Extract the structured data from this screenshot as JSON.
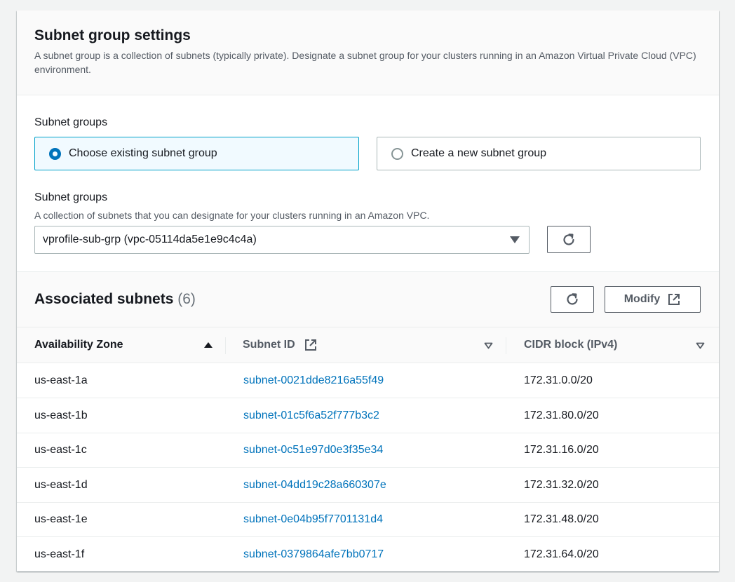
{
  "header": {
    "title": "Subnet group settings",
    "description": "A subnet group is a collection of subnets (typically private). Designate a subnet group for your clusters running in an Amazon Virtual Private Cloud (VPC) environment."
  },
  "subnet_group_choice": {
    "label": "Subnet groups",
    "options": [
      {
        "label": "Choose existing subnet group",
        "selected": true
      },
      {
        "label": "Create a new subnet group",
        "selected": false
      }
    ]
  },
  "subnet_group_select": {
    "label": "Subnet groups",
    "description": "A collection of subnets that you can designate for your clusters running in an Amazon VPC.",
    "value": "vprofile-sub-grp (vpc-05114da5e1e9c4c4a)"
  },
  "associated_subnets": {
    "title": "Associated subnets",
    "count": "(6)",
    "modify_label": "Modify",
    "columns": [
      "Availability Zone",
      "Subnet ID",
      "CIDR block (IPv4)"
    ],
    "rows": [
      {
        "az": "us-east-1a",
        "subnet_id": "subnet-0021dde8216a55f49",
        "cidr": "172.31.0.0/20"
      },
      {
        "az": "us-east-1b",
        "subnet_id": "subnet-01c5f6a52f777b3c2",
        "cidr": "172.31.80.0/20"
      },
      {
        "az": "us-east-1c",
        "subnet_id": "subnet-0c51e97d0e3f35e34",
        "cidr": "172.31.16.0/20"
      },
      {
        "az": "us-east-1d",
        "subnet_id": "subnet-04dd19c28a660307e",
        "cidr": "172.31.32.0/20"
      },
      {
        "az": "us-east-1e",
        "subnet_id": "subnet-0e04b95f7701131d4",
        "cidr": "172.31.48.0/20"
      },
      {
        "az": "us-east-1f",
        "subnet_id": "subnet-0379864afe7bb0717",
        "cidr": "172.31.64.0/20"
      }
    ]
  },
  "colors": {
    "link": "#0073bb",
    "selected_border": "#00a1c9",
    "selected_background": "#f1faff"
  }
}
